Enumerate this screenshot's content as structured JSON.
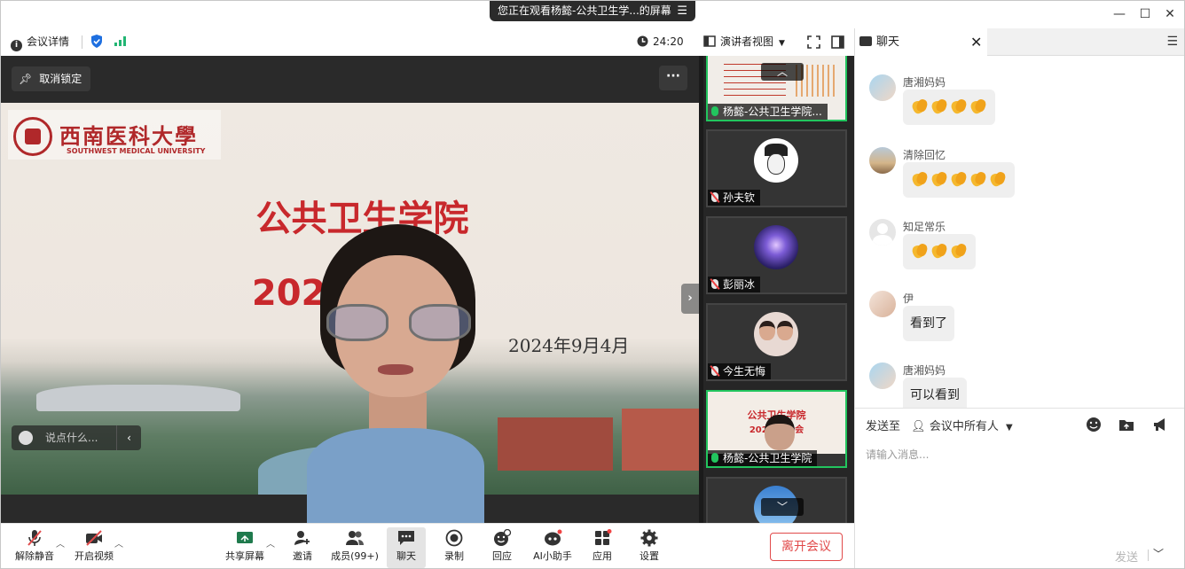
{
  "window": {
    "sharing_label": "您正在观看杨懿-公共卫生学...的屏幕",
    "menu_glyph": "☰",
    "minimize": "—",
    "maximize": "☐",
    "close": "✕"
  },
  "infobar": {
    "meeting_details": "会议详情",
    "timer": "24:20",
    "view_mode": "演讲者视图"
  },
  "stage": {
    "unlock_label": "取消锁定",
    "more_label": "···",
    "chat_placeholder": "说点什么...",
    "slide": {
      "logo_cn": "西南医科大學",
      "logo_en": "SOUTHWEST MEDICAL UNIVERSITY",
      "title_1": "公共卫生学院",
      "title_2": "2024级        长会",
      "date": "2024年9月4月"
    }
  },
  "participants": [
    {
      "name": "杨懿-公共卫生学院...",
      "mic": "on",
      "active": true
    },
    {
      "name": "孙夫钦",
      "mic": "off",
      "active": false
    },
    {
      "name": "彭丽冰",
      "mic": "off",
      "active": false
    },
    {
      "name": "今生无悔",
      "mic": "off",
      "active": false
    },
    {
      "name": "杨懿-公共卫生学院",
      "mic": "on",
      "active": true
    }
  ],
  "mini_slide": {
    "line1": "公共卫生学院",
    "line2": "2024级    长会"
  },
  "toolbar": {
    "unmute": "解除静音",
    "start_video": "开启视频",
    "share_screen": "共享屏幕",
    "invite": "邀请",
    "members": "成员(99+)",
    "chat": "聊天",
    "record": "录制",
    "reply": "回应",
    "ai_assistant": "AI小助手",
    "apps": "应用",
    "settings": "设置",
    "leave": "离开会议"
  },
  "chat": {
    "tab_label": "聊天",
    "messages": [
      {
        "sender": "唐湘妈妈",
        "text": "",
        "claps": 4
      },
      {
        "sender": "清除回忆",
        "text": "",
        "claps": 5
      },
      {
        "sender": "知足常乐",
        "text": "",
        "claps": 3
      },
      {
        "sender": "伊",
        "text": "看到了",
        "claps": 0
      },
      {
        "sender": "唐湘妈妈",
        "text": "可以看到",
        "claps": 0
      }
    ],
    "send_to_label": "发送至",
    "send_to_target": "会议中所有人",
    "input_placeholder": "请输入消息...",
    "send_label": "发送"
  },
  "colors": {
    "accent_green": "#22c55e",
    "leave_red": "#e14a4a",
    "slide_red": "#c8282c"
  }
}
